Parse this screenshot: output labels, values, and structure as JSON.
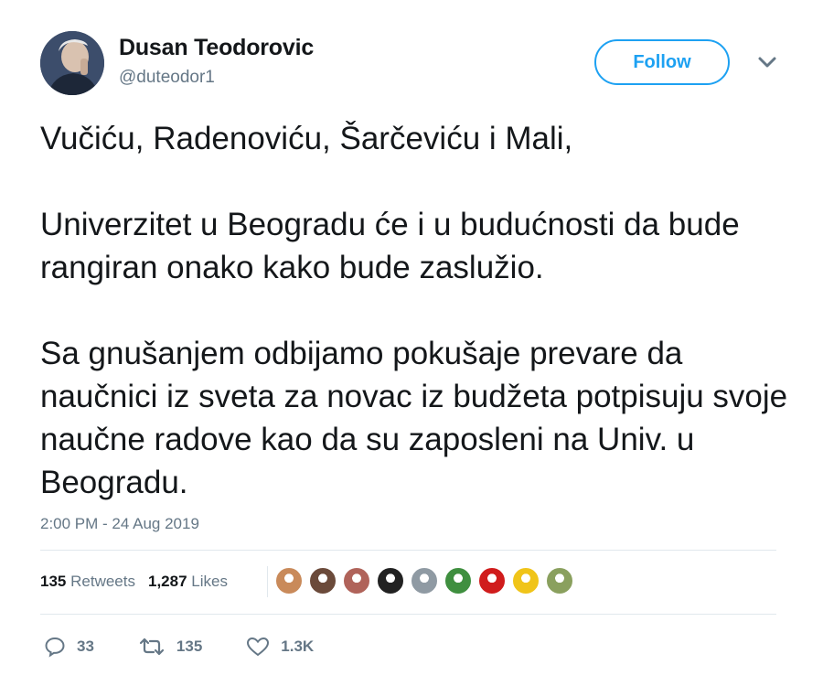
{
  "author": {
    "display_name": "Dusan Teodorovic",
    "handle": "@duteodor1"
  },
  "follow_label": "Follow",
  "tweet": {
    "paragraphs": [
      "Vučiću, Radenoviću, Šarčeviću i Mali,",
      "Univerzitet u Beogradu će i u budućnosti da bude rangiran onako kako bude zaslužio.",
      "Sa gnušanjem odbijamo pokušaje prevare da naučnici iz sveta za novac iz budžeta potpisuju svoje naučne radove kao da su zaposleni na Univ. u Beogradu."
    ],
    "timestamp": "2:00 PM - 24 Aug 2019"
  },
  "stats": {
    "retweets_count": "135",
    "retweets_label": "Retweets",
    "likes_count": "1,287",
    "likes_label": "Likes"
  },
  "likers": [
    {
      "icon": "liker-avatar-icon",
      "color": "#c98a5a"
    },
    {
      "icon": "liker-avatar-icon",
      "color": "#6b4a3a"
    },
    {
      "icon": "liker-avatar-icon",
      "color": "#b0635a"
    },
    {
      "icon": "liker-avatar-icon",
      "color": "#222222"
    },
    {
      "icon": "liker-avatar-icon",
      "color": "#8f9aa3"
    },
    {
      "icon": "liker-avatar-icon",
      "color": "#3f8f3f"
    },
    {
      "icon": "liker-avatar-icon",
      "color": "#d01c1c"
    },
    {
      "icon": "liker-avatar-icon",
      "color": "#f0c419"
    },
    {
      "icon": "liker-avatar-icon",
      "color": "#8aa05e"
    }
  ],
  "actions": {
    "replies": "33",
    "retweets": "135",
    "likes": "1.3K"
  },
  "colors": {
    "accent": "#1da1f2",
    "text": "#14171a",
    "muted": "#657786"
  }
}
